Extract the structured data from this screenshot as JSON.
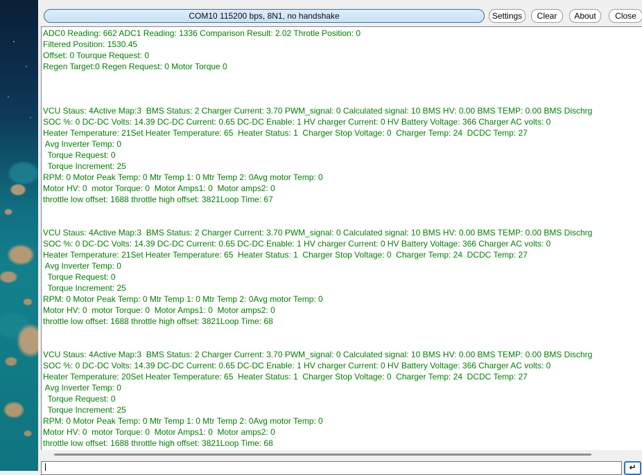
{
  "toolbar": {
    "port_status": "COM10 115200 bps, 8N1, no handshake",
    "settings_label": "Settings",
    "clear_label": "Clear",
    "about_label": "About",
    "close_label": "Close"
  },
  "terminal": {
    "text_color": "#008000",
    "lines": [
      "ADC0 Reading: 662 ADC1 Reading: 1336 Comparison Result: 2.02 Throtle Position: 0",
      "Filtered Position: 1530.45",
      "Offset: 0 Tourque Request: 0",
      "Regen Target:0 Regen Request: 0 Motor Torque 0",
      "",
      "",
      "",
      "VCU Staus: 4Active Map:3  BMS Status: 2 Charger Current: 3.70 PWM_signal: 0 Calculated signal: 10 BMS HV: 0.00 BMS TEMP: 0.00 BMS Dischrg",
      "SOC %: 0 DC-DC Volts: 14.39 DC-DC Current: 0.65 DC-DC Enable: 1 HV charger Current: 0 HV Battery Voltage: 366 Charger AC volts: 0",
      "Heater Temperature: 21Set Heater Temperature: 65  Heater Status: 1  Charger Stop Voltage: 0  Charger Temp: 24  DCDC Temp: 27",
      " Avg Inverter Temp: 0",
      "  Torque Request: 0",
      "  Torque Increment: 25",
      "RPM: 0 Motor Peak Temp: 0 Mtr Temp 1: 0 Mtr Temp 2: 0Avg motor Temp: 0",
      "Motor HV: 0  motor Torque: 0  Motor Amps1: 0  Motor amps2: 0",
      "throttle low offset: 1688 throttle high offset: 3821Loop Time: 67",
      "",
      "",
      "VCU Staus: 4Active Map:3  BMS Status: 2 Charger Current: 3.70 PWM_signal: 0 Calculated signal: 10 BMS HV: 0.00 BMS TEMP: 0.00 BMS Dischrg",
      "SOC %: 0 DC-DC Volts: 14.39 DC-DC Current: 0.65 DC-DC Enable: 1 HV charger Current: 0 HV Battery Voltage: 366 Charger AC volts: 0",
      "Heater Temperature: 21Set Heater Temperature: 65  Heater Status: 1  Charger Stop Voltage: 0  Charger Temp: 24  DCDC Temp: 27",
      " Avg Inverter Temp: 0",
      "  Torque Request: 0",
      "  Torque Increment: 25",
      "RPM: 0 Motor Peak Temp: 0 Mtr Temp 1: 0 Mtr Temp 2: 0Avg motor Temp: 0",
      "Motor HV: 0  motor Torque: 0  Motor Amps1: 0  Motor amps2: 0",
      "throttle low offset: 1688 throttle high offset: 3821Loop Time: 68",
      "",
      "",
      "VCU Staus: 4Active Map:3  BMS Status: 2 Charger Current: 3.70 PWM_signal: 0 Calculated signal: 10 BMS HV: 0.00 BMS TEMP: 0.00 BMS Dischrg",
      "SOC %: 0 DC-DC Volts: 14.39 DC-DC Current: 0.65 DC-DC Enable: 1 HV charger Current: 0 HV Battery Voltage: 366 Charger AC volts: 0",
      "Heater Temperature: 20Set Heater Temperature: 65  Heater Status: 1  Charger Stop Voltage: 0  Charger Temp: 24  DCDC Temp: 27",
      " Avg Inverter Temp: 0",
      "  Torque Request: 0",
      "  Torque Increment: 25",
      "RPM: 0 Motor Peak Temp: 0 Mtr Temp 1: 0 Mtr Temp 2: 0Avg motor Temp: 0",
      "Motor HV: 0  motor Torque: 0  Motor Amps1: 0  Motor amps2: 0",
      "throttle low offset: 1688 throttle high offset: 3821Loop Time: 68"
    ]
  },
  "transmit": {
    "value": "",
    "send_icon": "↵"
  }
}
